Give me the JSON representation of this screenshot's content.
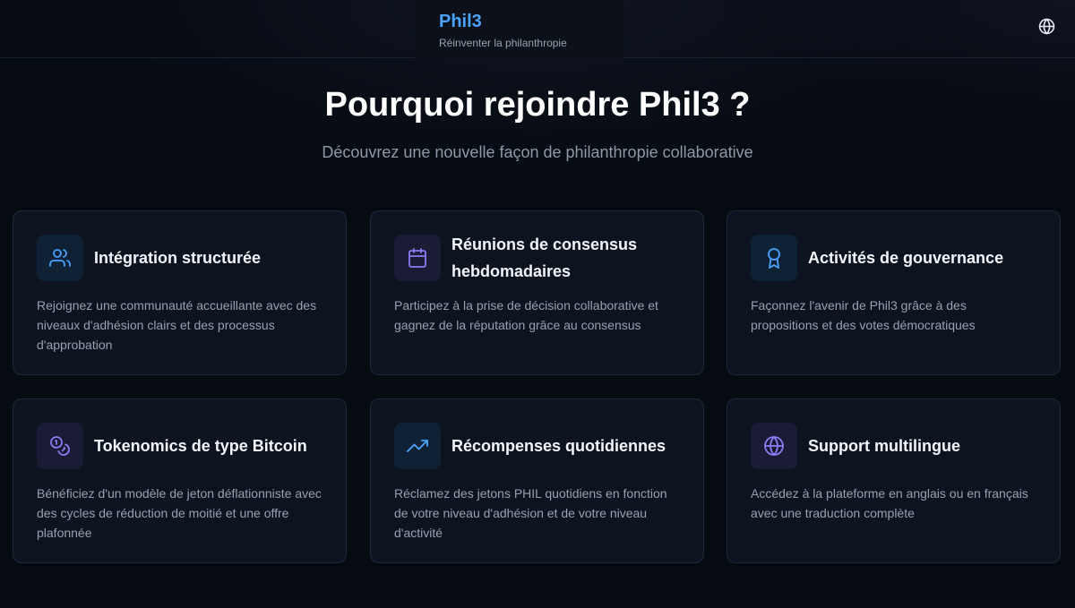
{
  "header": {
    "brand": "Phil3",
    "tagline": "Réinventer la philanthropie",
    "language_icon": "globe-icon"
  },
  "hero": {
    "title": "Pourquoi rejoindre Phil3 ?",
    "subtitle": "Découvrez une nouvelle façon de philanthropie collaborative"
  },
  "features": [
    {
      "icon": "users-icon",
      "title": "Intégration structurée",
      "description": "Rejoignez une communauté accueillante avec des niveaux d'adhésion clairs et des processus d'approbation"
    },
    {
      "icon": "calendar-icon",
      "title": "Réunions de consensus hebdomadaires",
      "description": "Participez à la prise de décision collaborative et gagnez de la réputation grâce au consensus"
    },
    {
      "icon": "award-icon",
      "title": "Activités de gouvernance",
      "description": "Façonnez l'avenir de Phil3 grâce à des propositions et des votes démocratiques"
    },
    {
      "icon": "coins-icon",
      "title": "Tokenomics de type Bitcoin",
      "description": "Bénéficiez d'un modèle de jeton déflationniste avec des cycles de réduction de moitié et une offre plafonnée"
    },
    {
      "icon": "trending-up-icon",
      "title": "Récompenses quotidiennes",
      "description": "Réclamez des jetons PHIL quotidiens en fonction de votre niveau d'adhésion et de votre niveau d'activité"
    },
    {
      "icon": "globe-icon",
      "title": "Support multilingue",
      "description": "Accédez à la plateforme en anglais ou en français avec une traduction complète"
    }
  ],
  "colors": {
    "accent_blue": "#4aa3ff",
    "accent_purple": "#8b7cf6",
    "background": "#070b12",
    "card": "#0d141f"
  }
}
